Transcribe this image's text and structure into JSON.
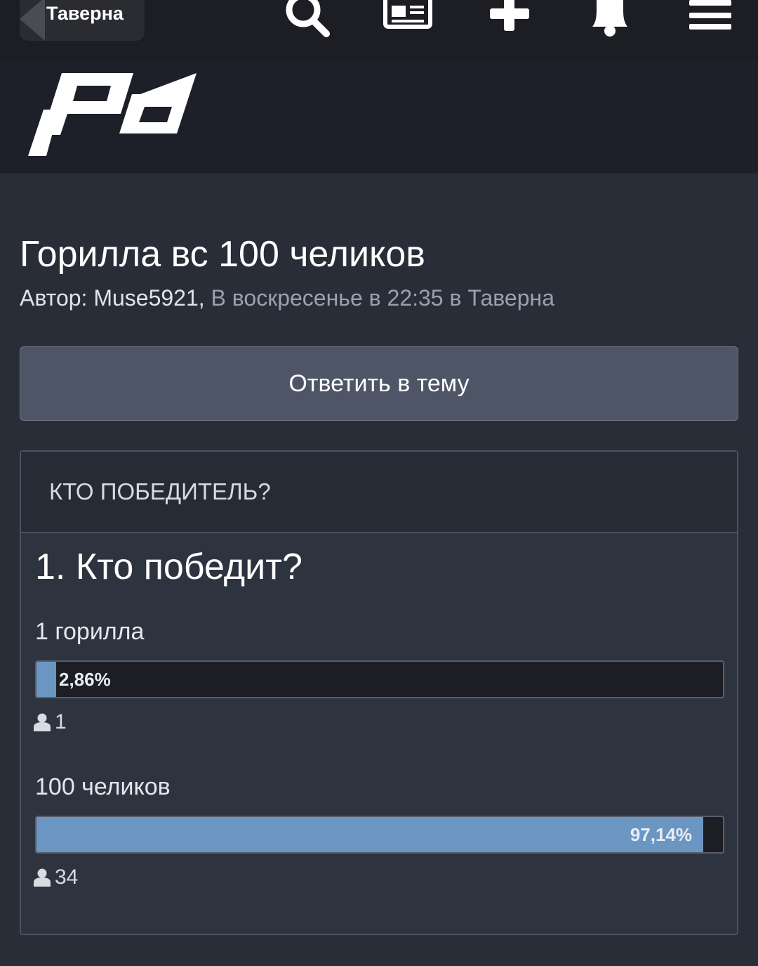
{
  "topbar": {
    "back_label": "Таверна",
    "icons": [
      "search-icon",
      "news-icon",
      "plus-icon",
      "bell-icon",
      "menu-icon"
    ]
  },
  "logo": {
    "text": "pd"
  },
  "topic": {
    "title": "Горилла вс 100 челиков",
    "author_label": "Автор:",
    "author": "Muse5921,",
    "posted": "В воскресенье в 22:35 в Таверна"
  },
  "reply_button": {
    "label": "Ответить в тему"
  },
  "poll": {
    "header": "КТО ПОБЕДИТЕЛЬ?",
    "question": "1. Кто победит?",
    "options": [
      {
        "label": "1 горилла",
        "percent_text": "2,86%",
        "percent": 2.86,
        "votes": "1"
      },
      {
        "label": "100 челиков",
        "percent_text": "97,14%",
        "percent": 97.14,
        "votes": "34"
      }
    ]
  },
  "colors": {
    "bar_fill": "#6b96c2",
    "background": "#282d38",
    "topbar": "#1c1e23"
  }
}
